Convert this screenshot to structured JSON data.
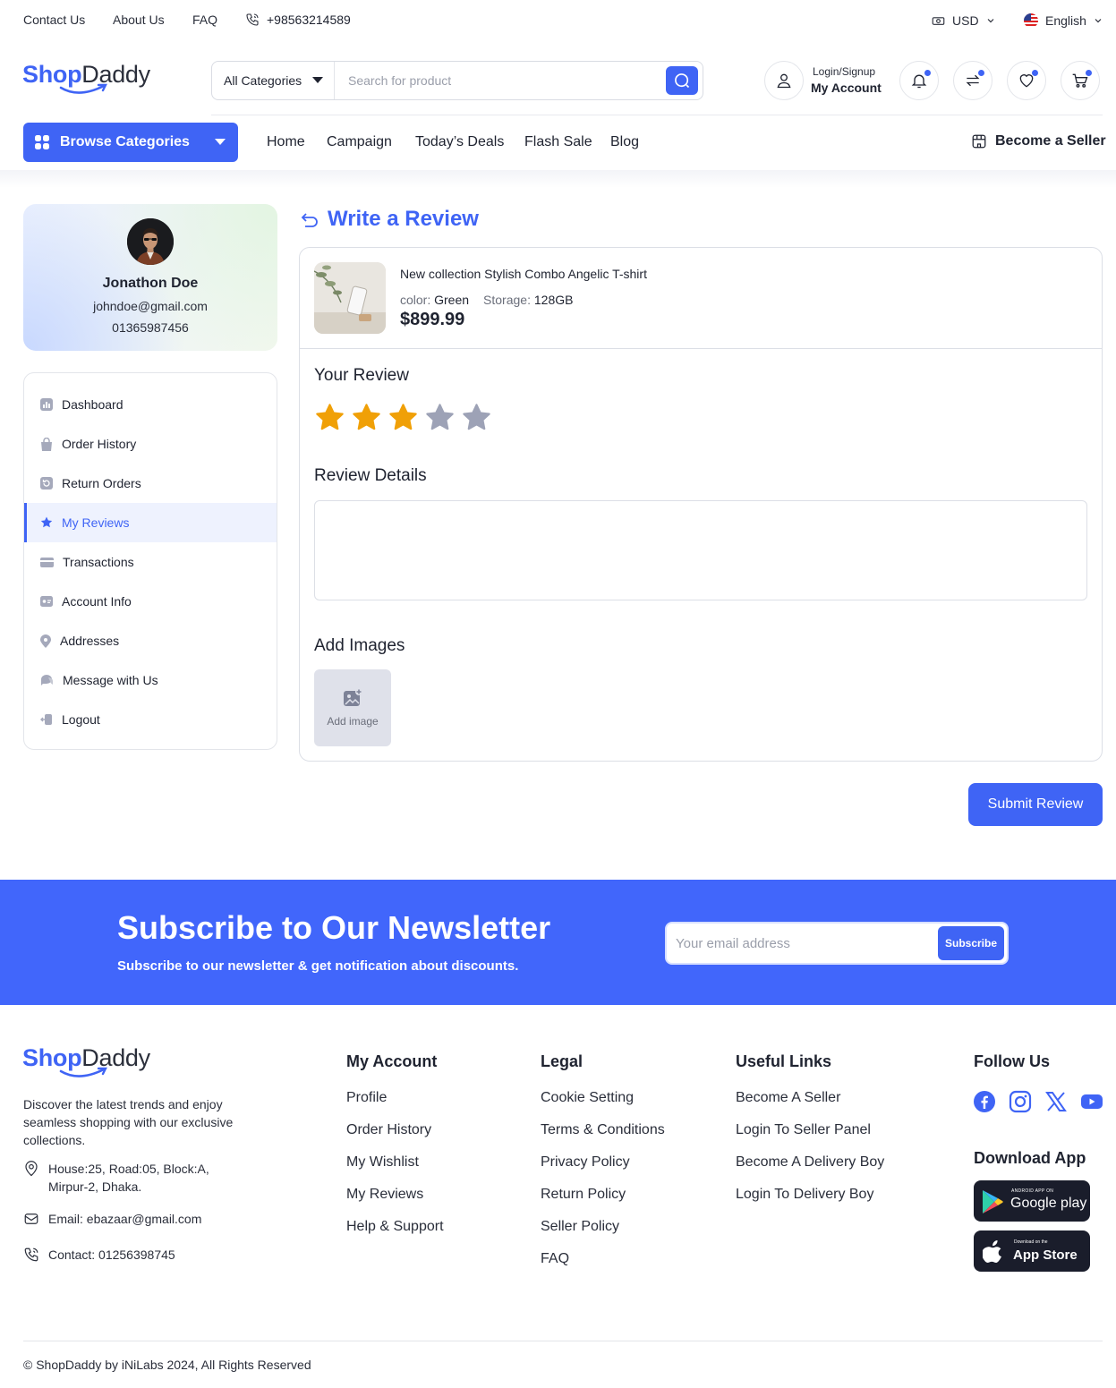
{
  "topbar": {
    "links": [
      "Contact Us",
      "About Us",
      "FAQ"
    ],
    "phone": "+98563214589",
    "currency": "USD",
    "language": "English"
  },
  "brand": {
    "part1": "Shop",
    "part2": "Daddy",
    "primary_color": "#3f64f5"
  },
  "search": {
    "category": "All Categories",
    "placeholder": "Search for product"
  },
  "account": {
    "small": "Login/Signup",
    "big": "My Account"
  },
  "header_icons": [
    "bell-icon",
    "compare-icon",
    "heart-icon",
    "cart-icon"
  ],
  "nav": {
    "browse": "Browse Categories",
    "links": [
      "Home",
      "Campaign",
      "Today’s Deals",
      "Flash Sale",
      "Blog"
    ],
    "seller": "Become a Seller"
  },
  "profile": {
    "name": "Jonathon Doe",
    "email": "johndoe@gmail.com",
    "phone": "01365987456"
  },
  "sidebar": {
    "items": [
      {
        "label": "Dashboard",
        "icon": "dashboard-icon"
      },
      {
        "label": "Order History",
        "icon": "bag-icon"
      },
      {
        "label": "Return Orders",
        "icon": "return-icon"
      },
      {
        "label": "My Reviews",
        "icon": "star-icon",
        "active": true
      },
      {
        "label": "Transactions",
        "icon": "card-icon"
      },
      {
        "label": "Account Info",
        "icon": "id-card-icon"
      },
      {
        "label": "Addresses",
        "icon": "location-icon"
      },
      {
        "label": "Message with Us",
        "icon": "chat-icon"
      },
      {
        "label": "Logout",
        "icon": "logout-icon"
      }
    ]
  },
  "review": {
    "title": "Write a Review",
    "product": {
      "name": "New collection Stylish Combo Angelic T-shirt",
      "color_label": "color:",
      "color": "Green",
      "storage_label": "Storage:",
      "storage": "128GB",
      "price": "$899.99"
    },
    "your_review": "Your Review",
    "rating": 3,
    "max_rating": 5,
    "star_active_color": "#f0a007",
    "star_inactive_color": "#9da2b6",
    "details_label": "Review Details",
    "details_value": "",
    "images_label": "Add Images",
    "add_image": "Add image",
    "submit": "Submit Review"
  },
  "newsletter": {
    "title": "Subscribe to Our Newsletter",
    "subtitle": "Subscribe to our newsletter & get notification about discounts.",
    "placeholder": "Your email address",
    "button": "Subscribe"
  },
  "footer": {
    "description": "Discover the latest trends and enjoy seamless shopping with our exclusive collections.",
    "address": "House:25, Road:05, Block:A, Mirpur-2, Dhaka.",
    "email": "Email: ebazaar@gmail.com",
    "contact": "Contact: 01256398745",
    "columns": [
      {
        "title": "My Account",
        "links": [
          "Profile",
          "Order History",
          "My Wishlist",
          "My Reviews",
          "Help & Support"
        ]
      },
      {
        "title": "Legal",
        "links": [
          "Cookie Setting",
          "Terms & Conditions",
          "Privacy Policy",
          "Return Policy",
          "Seller Policy",
          "FAQ"
        ]
      },
      {
        "title": "Useful Links",
        "links": [
          "Become A Seller",
          "Login To Seller Panel",
          "Become A Delivery Boy",
          "Login To Delivery Boy"
        ]
      }
    ],
    "follow": "Follow Us",
    "socials": [
      "facebook-icon",
      "instagram-icon",
      "x-icon",
      "youtube-icon"
    ],
    "download": "Download App",
    "google_small": "ANDROID APP ON",
    "google_big": "Google play",
    "apple_small": "Download on the",
    "apple_big": "App Store",
    "copyright": "© ShopDaddy by iNiLabs 2024, All Rights Reserved"
  }
}
